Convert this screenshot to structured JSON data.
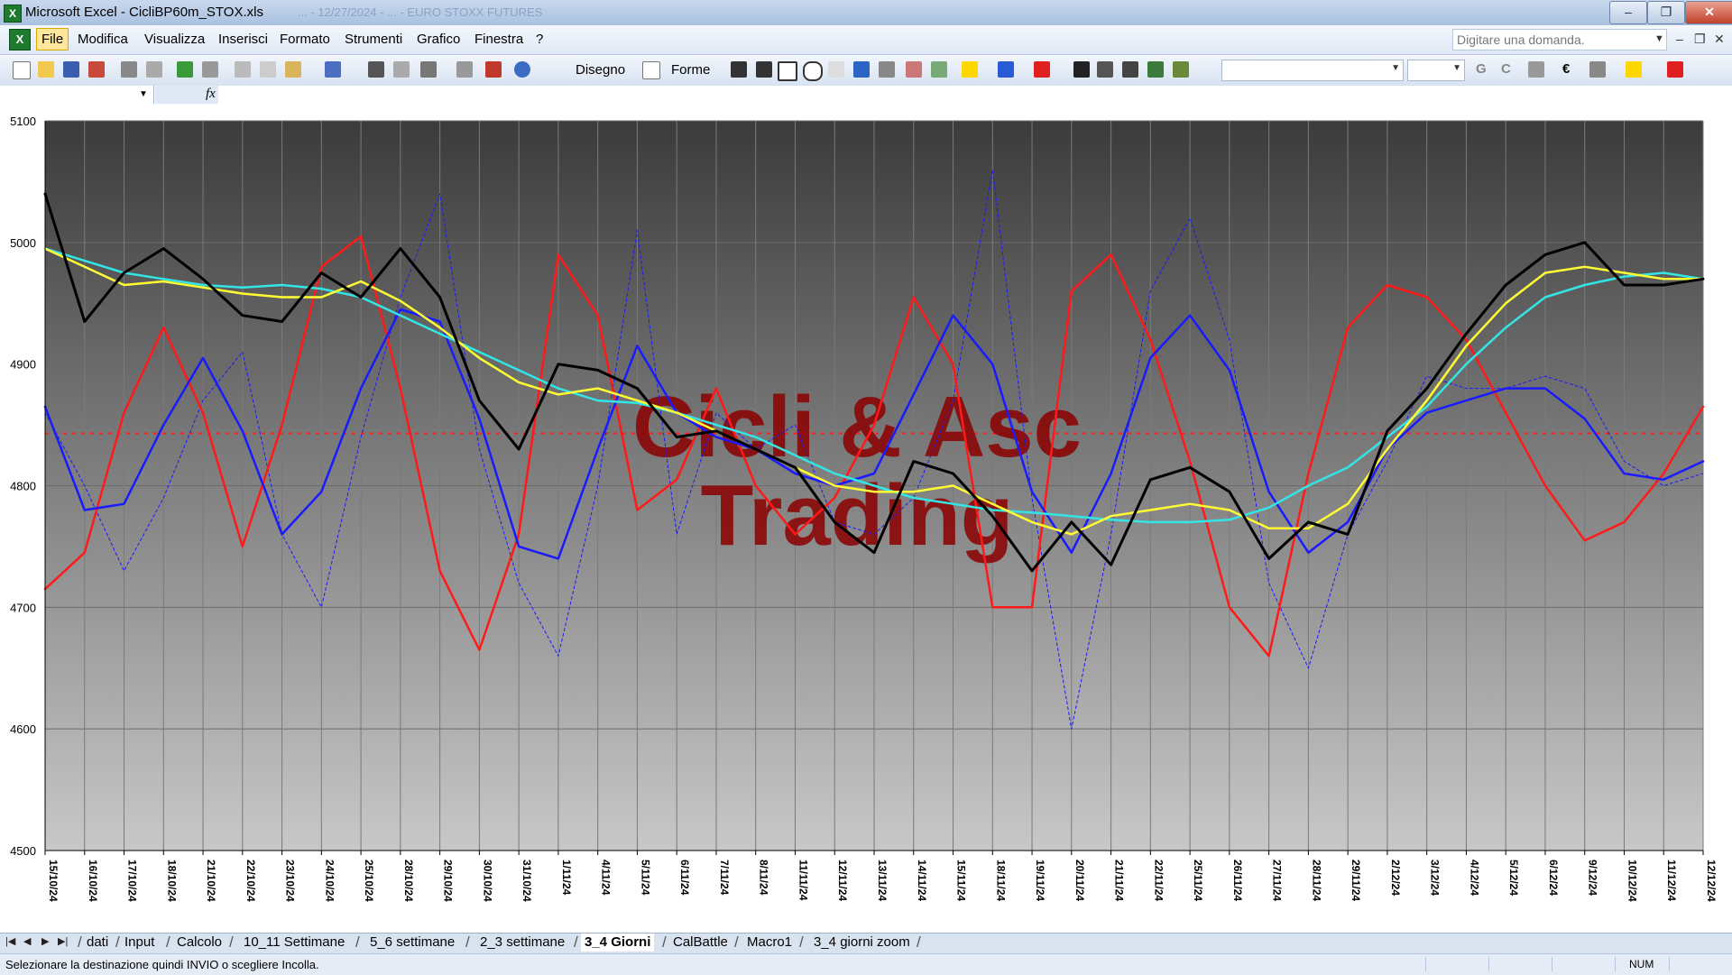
{
  "window": {
    "title": "Microsoft Excel - CicliBP60m_STOX.xls",
    "ghost_title": "... - 12/27/2024 - ... - EURO STOXX FUTURES",
    "min_label": "–",
    "max_label": "❐",
    "close_label": "✕"
  },
  "menu": {
    "items": [
      "File",
      "Modifica",
      "Visualizza",
      "Inserisci",
      "Formato",
      "Strumenti",
      "Grafico",
      "Finestra",
      "?"
    ],
    "help_placeholder": "Digitare una domanda."
  },
  "toolbar": {
    "draw_label": "Disegno",
    "shapes_label": "Forme",
    "bold_label": "G",
    "italic_label": "C",
    "euro_label": "€"
  },
  "colors": {
    "black": "#000000",
    "red": "#ff1a1a",
    "blue": "#1a1aff",
    "yellow": "#ffff33",
    "cyan": "#33e5e5",
    "refline": "#ff2020",
    "watermark": "#8b0000"
  },
  "chart_data": {
    "type": "line",
    "title": "",
    "watermark": [
      "Cicli & Asc",
      "Trading"
    ],
    "ylim": [
      4500,
      5100
    ],
    "yticks": [
      4500,
      4600,
      4700,
      4800,
      4900,
      5000,
      5100
    ],
    "grid": true,
    "reference_line": 4843,
    "x_labels": [
      "15/10/24",
      "16/10/24",
      "17/10/24",
      "18/10/24",
      "21/10/24",
      "22/10/24",
      "23/10/24",
      "24/10/24",
      "25/10/24",
      "28/10/24",
      "29/10/24",
      "30/10/24",
      "31/10/24",
      "1/11/24",
      "4/11/24",
      "5/11/24",
      "6/11/24",
      "7/11/24",
      "8/11/24",
      "11/11/24",
      "12/11/24",
      "13/11/24",
      "14/11/24",
      "15/11/24",
      "18/11/24",
      "19/11/24",
      "20/11/24",
      "21/11/24",
      "22/11/24",
      "25/11/24",
      "26/11/24",
      "27/11/24",
      "28/11/24",
      "29/11/24",
      "2/12/24",
      "3/12/24",
      "4/12/24",
      "5/12/24",
      "6/12/24",
      "9/12/24",
      "10/12/24",
      "11/12/24",
      "12/12/24"
    ],
    "series": [
      {
        "color": "#000000",
        "width": 3,
        "values": [
          5040,
          4935,
          4975,
          4995,
          4970,
          4940,
          4935,
          4975,
          4955,
          4995,
          4955,
          4870,
          4830,
          4900,
          4895,
          4880,
          4840,
          4845,
          4830,
          4815,
          4770,
          4745,
          4820,
          4810,
          4775,
          4730,
          4770,
          4735,
          4805,
          4815,
          4795,
          4740,
          4770,
          4760,
          4845,
          4880,
          4925,
          4965,
          4990,
          5000,
          4965,
          4965,
          4970
        ]
      },
      {
        "color": "#ff1a1a",
        "width": 2.5,
        "values": [
          4715,
          4745,
          4860,
          4930,
          4860,
          4750,
          4850,
          4980,
          5005,
          4880,
          4730,
          4665,
          4760,
          4990,
          4940,
          4780,
          4805,
          4880,
          4800,
          4760,
          4790,
          4850,
          4955,
          4900,
          4700,
          4700,
          4960,
          4990,
          4920,
          4820,
          4700,
          4660,
          4810,
          4930,
          4965,
          4955,
          4920,
          4860,
          4800,
          4755,
          4770,
          4810,
          4865
        ]
      },
      {
        "color": "#1a1aff",
        "width": 2.5,
        "values": [
          4865,
          4780,
          4785,
          4850,
          4905,
          4845,
          4760,
          4795,
          4880,
          4945,
          4935,
          4855,
          4750,
          4740,
          4830,
          4915,
          4860,
          4840,
          4830,
          4810,
          4800,
          4810,
          4875,
          4940,
          4900,
          4795,
          4745,
          4810,
          4905,
          4940,
          4895,
          4795,
          4745,
          4770,
          4830,
          4860,
          4870,
          4880,
          4880,
          4855,
          4810,
          4805,
          4820
        ]
      },
      {
        "color": "#ffff33",
        "width": 2.5,
        "values": [
          4995,
          4980,
          4965,
          4968,
          4963,
          4958,
          4955,
          4955,
          4968,
          4952,
          4930,
          4905,
          4885,
          4875,
          4880,
          4870,
          4860,
          4845,
          4830,
          4815,
          4800,
          4795,
          4795,
          4800,
          4785,
          4770,
          4760,
          4775,
          4780,
          4785,
          4780,
          4765,
          4765,
          4785,
          4830,
          4870,
          4915,
          4950,
          4975,
          4980,
          4975,
          4970,
          4970
        ]
      },
      {
        "color": "#33e5e5",
        "width": 2.5,
        "values": [
          4995,
          4985,
          4975,
          4970,
          4965,
          4963,
          4965,
          4962,
          4955,
          4940,
          4925,
          4910,
          4895,
          4880,
          4870,
          4868,
          4860,
          4850,
          4840,
          4825,
          4810,
          4800,
          4790,
          4785,
          4780,
          4778,
          4775,
          4772,
          4770,
          4770,
          4772,
          4782,
          4800,
          4815,
          4840,
          4865,
          4900,
          4930,
          4955,
          4965,
          4972,
          4975,
          4970
        ]
      },
      {
        "color": "#1a1aff",
        "width": 1,
        "dashed": true,
        "values": [
          4860,
          4800,
          4730,
          4790,
          4870,
          4910,
          4760,
          4700,
          4840,
          4955,
          5040,
          4830,
          4720,
          4660,
          4800,
          5010,
          4760,
          4860,
          4830,
          4850,
          4770,
          4760,
          4790,
          4870,
          5060,
          4790,
          4600,
          4760,
          4960,
          5020,
          4920,
          4720,
          4650,
          4760,
          4820,
          4890,
          4880,
          4880,
          4890,
          4880,
          4820,
          4800,
          4810
        ]
      }
    ]
  },
  "sheet_tabs": {
    "items": [
      "dati",
      "Input",
      "Calcolo",
      "10_11 Settimane",
      "5_6 settimane",
      "2_3 settimane",
      "3_4 Giorni",
      "CalBattle",
      "Macro1",
      "3_4 giorni zoom"
    ],
    "active_index": 6
  },
  "status": {
    "message": "Selezionare la destinazione quindi INVIO o scegliere Incolla.",
    "num": "NUM"
  }
}
